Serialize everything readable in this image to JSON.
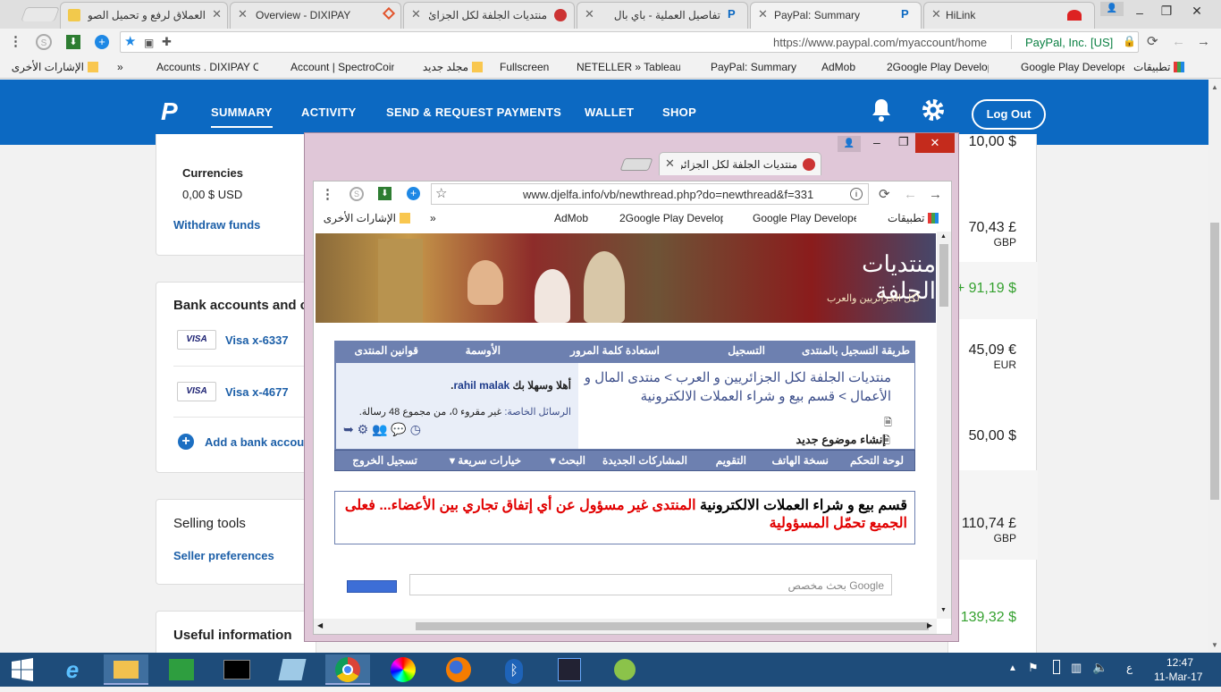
{
  "tabs": [
    {
      "title": "العملاق لرفع و تحميل الصو",
      "active": false
    },
    {
      "title": "Overview - DIXIPAY",
      "active": false
    },
    {
      "title": "منتديات الجلفة لكل الجزائ",
      "active": false
    },
    {
      "title": "تفاصيل العملية - باي بال",
      "active": false
    },
    {
      "title": "PayPal: Summary",
      "active": true
    },
    {
      "title": "HiLink",
      "active": false
    }
  ],
  "omnibox": {
    "url": "https://www.paypal.com/myaccount/home",
    "site_identity": "PayPal, Inc. [US]"
  },
  "bookmarks": [
    {
      "label": "تطبيقات"
    },
    {
      "label": "Google Play Develope"
    },
    {
      "label": "2Google Play Develop"
    },
    {
      "label": "AdMob"
    },
    {
      "label": "PayPal: Summary"
    },
    {
      "label": "NETELLER » Tableau d"
    },
    {
      "label": "Fullscreen"
    },
    {
      "label": "مجلد جديد"
    },
    {
      "label": "Account | SpectroCoin"
    },
    {
      "label": "Accounts . DIXIPAY Ol"
    },
    {
      "label": "»"
    },
    {
      "label": "الإشارات الأخرى"
    }
  ],
  "paypal": {
    "nav": [
      "SUMMARY",
      "ACTIVITY",
      "SEND & REQUEST PAYMENTS",
      "WALLET",
      "SHOP"
    ],
    "logout_label": "Log Out",
    "currencies_label": "Currencies",
    "usd_balance": "0,00 $ USD",
    "withdraw_label": "Withdraw funds",
    "bank_heading": "Bank accounts and c",
    "visa_logo": "VISA",
    "cards": [
      {
        "label": "Visa x-6337"
      },
      {
        "label": "Visa x-4677"
      }
    ],
    "add_bank_label": "Add a bank accou",
    "selling_heading": "Selling tools",
    "seller_prefs_label": "Seller preferences",
    "useful_heading": "Useful information",
    "amounts": [
      {
        "value": "70,43 £",
        "currency": "GBP",
        "color": "#222222"
      },
      {
        "value": "+ 91,19 $",
        "currency": "",
        "color": "#35a12f"
      },
      {
        "value": "45,09 €",
        "currency": "EUR",
        "color": "#222222"
      },
      {
        "value": "50,00 $",
        "currency": "",
        "color": "#222222"
      },
      {
        "value": "110,74 £",
        "currency": "GBP",
        "color": "#222222"
      },
      {
        "value": "139,32 $",
        "currency": "",
        "color": "#35a12f"
      }
    ],
    "top_partial_amount": "10,00 $"
  },
  "popup": {
    "tab_title": "منتديات الجلفة لكل الجزائر",
    "url": "www.djelfa.info/vb/newthread.php?do=newthread&f=331",
    "bookmarks": [
      {
        "label": "تطبيقات"
      },
      {
        "label": "Google Play Develope"
      },
      {
        "label": "2Google Play Develop"
      },
      {
        "label": "AdMob"
      },
      {
        "label": "»"
      },
      {
        "label": "الإشارات الأخرى"
      }
    ],
    "banner_title": "منتديات الجلفة",
    "banner_subtitle": "لكل الجزائريين والعرب",
    "forum_nav": [
      "طريقة التسجيل بالمنتدى",
      "التسجيل",
      "استعادة كلمة المرور",
      "الأوسمة",
      "قوانين المنتدى"
    ],
    "breadcrumb": "منتديات الجلفة لكل الجزائريين و العرب > منتدى المال و الأعمال > قسم بيع و شراء العملات الالكترونية",
    "new_thread": "إنشاء موضوع جديد",
    "welcome_prefix": "أهلا وسهلا بك",
    "username": "rahil malak",
    "pm_label": "الرسائل الخاصة:",
    "pm_text": "غير مقروء 0، من مجموع 48 رسالة.",
    "tools_nav": [
      "لوحة التحكم",
      "نسخة الهاتف",
      "التقويم",
      "المشاركات الجديدة",
      "البحث",
      "خيارات سريعة",
      "تسجيل الخروج"
    ],
    "notice_black": "قسم بيع و شراء العملات الالكترونية",
    "notice_red": "المنتدى غير مسؤول عن أي إتفاق تجاري بين الأعضاء... فعلى الجميع تحمّل المسؤولية",
    "search_placeholder": "Google بحث مخصص"
  },
  "taskbar": {
    "apps": [
      "start-icon",
      "internet-explorer-icon",
      "file-explorer-icon",
      "store-icon",
      "command-prompt-icon",
      "notes-icon",
      "chrome-icon",
      "color-app-icon",
      "firefox-icon",
      "bluetooth-icon",
      "pen-app-icon",
      "android-studio-icon"
    ],
    "time": "12:47",
    "date": "11-Mar-17",
    "ime": "ع"
  }
}
